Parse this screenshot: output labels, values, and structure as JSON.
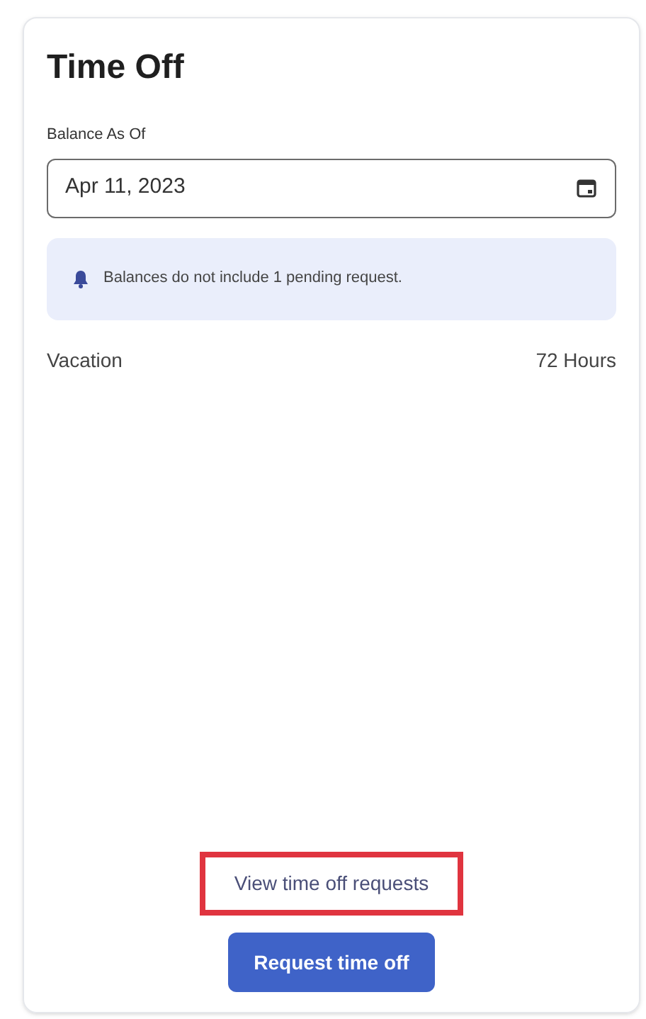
{
  "card": {
    "title": "Time Off"
  },
  "balance_field": {
    "label": "Balance As Of",
    "value": "Apr 11, 2023"
  },
  "notice": {
    "text": "Balances do not include 1 pending request."
  },
  "balances": [
    {
      "name": "Vacation",
      "amount": "72 Hours"
    }
  ],
  "link": {
    "text": "View time off requests",
    "highlighted": true
  },
  "button": {
    "text": "Request time off"
  }
}
